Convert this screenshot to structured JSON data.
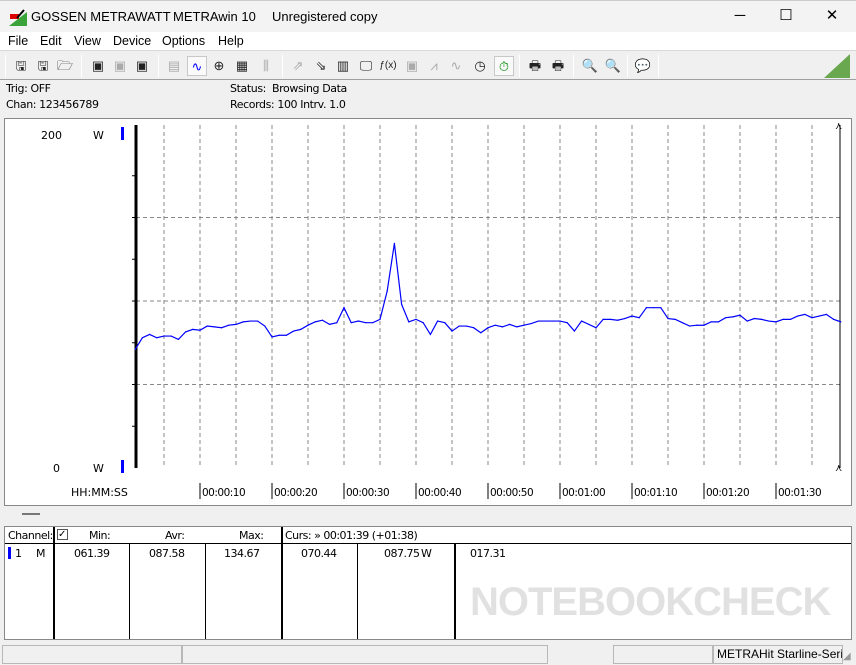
{
  "titlebar": {
    "company": "GOSSEN METRAWATT",
    "app": "METRAwin 10",
    "license": "Unregistered copy",
    "minimize": "─",
    "maximize": "☐",
    "close": "✕"
  },
  "menu": [
    "File",
    "Edit",
    "View",
    "Device",
    "Options",
    "Help"
  ],
  "toolbar_icons": [
    "save-icon",
    "save-as-icon",
    "open-folder-icon",
    "read-memory-icon",
    "read-memory-disabled-icon",
    "multimeter-icon",
    "numeric-display-icon",
    "scope-display-icon",
    "xy-display-icon",
    "table-display-icon",
    "bar-display-icon",
    "export-icon",
    "import-icon",
    "data-config-icon",
    "monitor-icon",
    "function-icon",
    "device-icon",
    "trigger-icon",
    "wave-icon",
    "timer-icon",
    "stopwatch-icon",
    "print-icon",
    "print-preview-icon",
    "zoom-wave-icon",
    "zoom-sine-icon",
    "comment-icon"
  ],
  "info": {
    "trig": "Trig: OFF",
    "chan": "Chan:  123456789",
    "status_label": "Status:",
    "status_value": "Browsing Data",
    "records": "Records: 100   Intrv. 1.0"
  },
  "chart_data": {
    "type": "line",
    "ylim": [
      0,
      200
    ],
    "ytick_top": "200",
    "ytick_bottom": "0",
    "yunit": "W",
    "xlabel": "HH:MM:SS",
    "xticks": [
      "00:00:10",
      "00:00:20",
      "00:00:30",
      "00:00:40",
      "00:00:50",
      "00:01:00",
      "00:01:10",
      "00:01:20",
      "00:01:30"
    ],
    "xlim_seconds": [
      0,
      99
    ],
    "grid": true,
    "line_color": "#0000ff",
    "x": [
      1,
      2,
      3,
      4,
      5,
      6,
      7,
      8,
      9,
      10,
      11,
      12,
      13,
      14,
      15,
      16,
      17,
      18,
      19,
      20,
      21,
      22,
      23,
      24,
      25,
      26,
      27,
      28,
      29,
      30,
      31,
      32,
      33,
      34,
      35,
      36,
      37,
      38,
      39,
      40,
      41,
      42,
      43,
      44,
      45,
      46,
      47,
      48,
      49,
      50,
      51,
      52,
      53,
      54,
      55,
      56,
      57,
      58,
      59,
      60,
      61,
      62,
      63,
      64,
      65,
      66,
      67,
      68,
      69,
      70,
      71,
      72,
      73,
      74,
      75,
      76,
      77,
      78,
      79,
      80,
      81,
      82,
      83,
      84,
      85,
      86,
      87,
      88,
      89,
      90,
      91,
      92,
      93,
      94,
      95,
      96,
      97,
      98,
      99
    ],
    "values": [
      71,
      78,
      80,
      78,
      79,
      79,
      77,
      81.5,
      83,
      82.5,
      85,
      84.5,
      84,
      85.5,
      86,
      87.5,
      88,
      88,
      85,
      78.5,
      79.5,
      79.5,
      82,
      83,
      85.5,
      87.5,
      88.5,
      86,
      87,
      96,
      87,
      88,
      87,
      87,
      89,
      106,
      134.5,
      98,
      87.5,
      89,
      87,
      80,
      88,
      87,
      82,
      85,
      85,
      84,
      81,
      84,
      85.5,
      84.5,
      86,
      84.5,
      85.5,
      86.5,
      88,
      88,
      88,
      88,
      87,
      82,
      88,
      86,
      84,
      89,
      89,
      88.5,
      89.5,
      91,
      90,
      96,
      96,
      96,
      89.5,
      89,
      87,
      85,
      85.5,
      85.5,
      87.5,
      87.5,
      90,
      90.5,
      91.5,
      88,
      89.5,
      89,
      88,
      87.5,
      89,
      89,
      91,
      92,
      90,
      91,
      92,
      89,
      87.5
    ]
  },
  "table": {
    "headers": {
      "channel": "Channel:",
      "min": "Min:",
      "avr": "Avr:",
      "max": "Max:",
      "cursor": "Curs: » 00:01:39 (+01:38)"
    },
    "row": {
      "channel": "1",
      "mode": "M",
      "min": "061.39",
      "avr": "087.58",
      "max": "134.67",
      "curs1": "070.44",
      "curs2": "087.75",
      "unit": "W",
      "curs3": "017.31"
    },
    "channel_color": "#0000ff"
  },
  "statusbar": {
    "device": "METRAHit Starline-Seri"
  },
  "watermark": "NOTEBOOKCHECK"
}
